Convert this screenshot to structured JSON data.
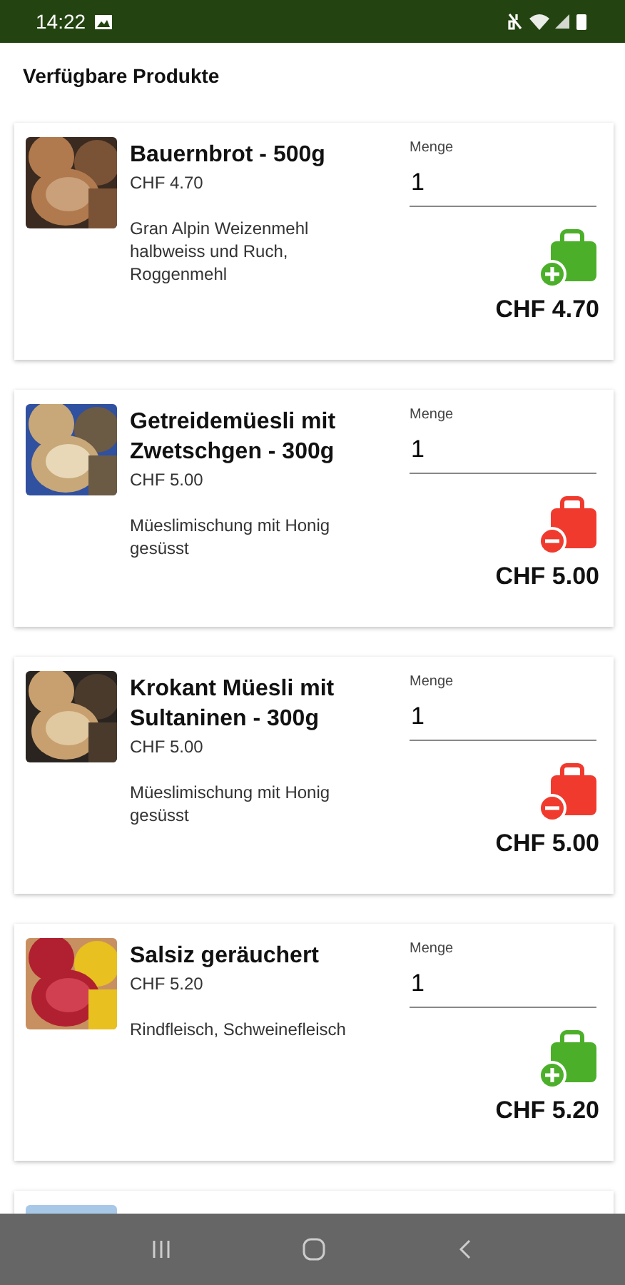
{
  "status_bar": {
    "time": "14:22"
  },
  "title": "Verfügbare Produkte",
  "products": [
    {
      "name": "Bauernbrot - 500g",
      "price": "CHF 4.70",
      "description": "Gran Alpin Weizenmehl halbweiss und Ruch, Roggenmehl",
      "quantity_label": "Menge",
      "quantity": "1",
      "in_cart": false,
      "total": "CHF 4.70"
    },
    {
      "name": "Getreidemüesli mit Zwetschgen - 300g",
      "price": "CHF 5.00",
      "description": "Müeslimischung mit Honig gesüsst",
      "quantity_label": "Menge",
      "quantity": "1",
      "in_cart": true,
      "total": "CHF 5.00"
    },
    {
      "name": "Krokant Müesli mit Sultaninen - 300g",
      "price": "CHF 5.00",
      "description": "Müeslimischung mit Honig gesüsst",
      "quantity_label": "Menge",
      "quantity": "1",
      "in_cart": true,
      "total": "CHF 5.00"
    },
    {
      "name": "Salsiz geräuchert",
      "price": "CHF 5.20",
      "description": "Rindfleisch, Schweinefleisch",
      "quantity_label": "Menge",
      "quantity": "1",
      "in_cart": false,
      "total": "CHF 5.20"
    }
  ]
}
